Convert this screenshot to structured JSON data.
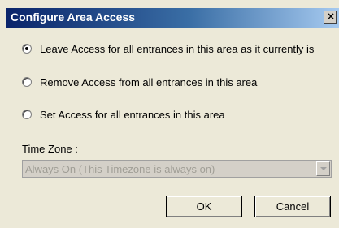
{
  "window": {
    "title": "Configure Area Access",
    "close_glyph": "×",
    "close_icon": "close-icon"
  },
  "options": [
    {
      "label": "Leave Access for all entrances in this area as it currently is",
      "selected": true
    },
    {
      "label": "Remove Access from all entrances in this area",
      "selected": false
    },
    {
      "label": "Set Access for all entrances in this area",
      "selected": false
    }
  ],
  "timezone": {
    "label": "Time Zone :",
    "value": "Always On (This Timezone is always on)",
    "disabled": true
  },
  "buttons": {
    "ok": "OK",
    "cancel": "Cancel"
  },
  "colors": {
    "title_bar_start": "#0a246a",
    "title_bar_end": "#a6caf0",
    "dialog_bg": "#ece9d8"
  }
}
